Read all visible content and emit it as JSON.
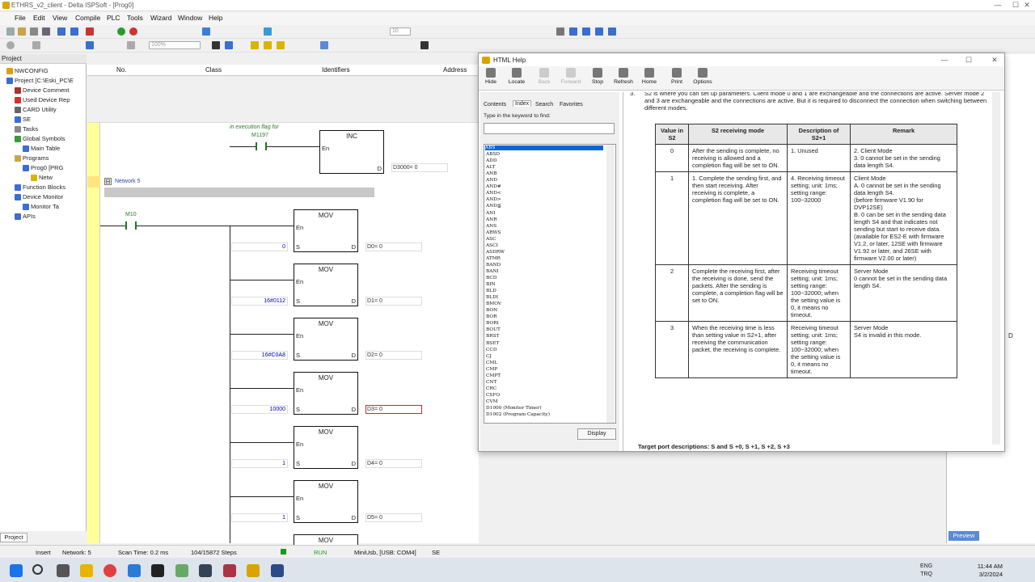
{
  "window": {
    "title": "ETHRS_v2_client - Delta ISPSoft - [Prog0]",
    "controls": [
      "—",
      "☐",
      "✕"
    ]
  },
  "menu": [
    "File",
    "Edit",
    "View",
    "Compile",
    "PLC",
    "Tools",
    "Wizard",
    "Window",
    "Help"
  ],
  "toolbar": {
    "zoom": "100%",
    "step": "10"
  },
  "project": {
    "header": "Project",
    "items": [
      {
        "label": "NWCONFIG",
        "indent": 0
      },
      {
        "label": "Project [C:\\Eski_PC\\E",
        "indent": 0
      },
      {
        "label": "Device Comment",
        "indent": 1
      },
      {
        "label": "Used Device Rep",
        "indent": 1
      },
      {
        "label": "CARD Utility",
        "indent": 1
      },
      {
        "label": "SE",
        "indent": 1
      },
      {
        "label": "Tasks",
        "indent": 1
      },
      {
        "label": "Global Symbols",
        "indent": 1
      },
      {
        "label": "Main Table",
        "indent": 2
      },
      {
        "label": "Programs",
        "indent": 1
      },
      {
        "label": "Prog0 [PRG",
        "indent": 2
      },
      {
        "label": "Netw",
        "indent": 3
      },
      {
        "label": "Function Blocks",
        "indent": 1
      },
      {
        "label": "Device Monitor",
        "indent": 1
      },
      {
        "label": "Monitor Ta",
        "indent": 2
      },
      {
        "label": "APIs",
        "indent": 1
      }
    ],
    "footer_tab": "Project"
  },
  "table_header": {
    "no": "No.",
    "class": "Class",
    "identifiers": "Identifiers",
    "address": "Address"
  },
  "ladder": {
    "comment": "in execution flag for",
    "network_label": "Network 5",
    "top_contact": "M1197",
    "inc_block": {
      "name": "INC",
      "en": "En",
      "d": "D",
      "out": "D3000= 0"
    },
    "contact": "M10",
    "movs": [
      {
        "name": "MOV",
        "src": "0",
        "out": "D0= 0"
      },
      {
        "name": "MOV",
        "src": "16#0112",
        "out": "D1= 0"
      },
      {
        "name": "MOV",
        "src": "16#C0A8",
        "out": "D2= 0"
      },
      {
        "name": "MOV",
        "src": "10000",
        "out": "D3= 0"
      },
      {
        "name": "MOV",
        "src": "1",
        "out": "D4= 0"
      },
      {
        "name": "MOV",
        "src": "1",
        "out": "D5= 0"
      },
      {
        "name": "MOV",
        "src": "",
        "out": ""
      }
    ],
    "pin_en": "En",
    "pin_s": "S",
    "pin_d": "D"
  },
  "help": {
    "title": "HTML Help",
    "tools": [
      {
        "label": "Hide",
        "enabled": true
      },
      {
        "label": "Locate",
        "enabled": true
      },
      {
        "label": "Back",
        "enabled": false
      },
      {
        "label": "Forward",
        "enabled": false
      },
      {
        "label": "Stop",
        "enabled": true
      },
      {
        "label": "Refresh",
        "enabled": true
      },
      {
        "label": "Home",
        "enabled": true
      },
      {
        "label": "Print",
        "enabled": true
      },
      {
        "label": "Options",
        "enabled": true
      }
    ],
    "tabs": [
      "Contents",
      "Index",
      "Search",
      "Favorites"
    ],
    "keyword_label": "Type in the keyword to find:",
    "keywords": [
      "ABS",
      "ABSD",
      "ADD",
      "ALT",
      "ANB",
      "AND",
      "AND#",
      "AND<",
      "AND>",
      "AND≦",
      "ANI",
      "ANR",
      "ANS",
      "ARWS",
      "ASC",
      "ASCI",
      "ASDRW",
      "ATMR",
      "BAND",
      "BANI",
      "BCD",
      "BIN",
      "BLD",
      "BLDI",
      "BMOV",
      "BON",
      "BOR",
      "BORI",
      "BOUT",
      "BRST",
      "BSET",
      "CCD",
      "CJ",
      "CML",
      "CMP",
      "CMPT",
      "CNT",
      "CRC",
      "CSFO",
      "CVM",
      "D1000 (Monitor Timer)",
      "D1002 (Program Capacity)"
    ],
    "display_button": "Display",
    "intro": "S2 is where you can set up parameters. Client mode 0 and 1 are exchangeable and the connections are active. Server mode 2 and 3 are exchangeable and the connections are active. But it is required to disconnect the connection when switching between different modes.",
    "intro_prefix": "3.",
    "table": {
      "headers": [
        "Value in S2",
        "S2 receiving mode",
        "Description of S2+1",
        "Remark"
      ],
      "rows": [
        {
          "value": "0",
          "mode": "After the sending is complete, no receiving is allowed and a completion flag will be set to ON.",
          "desc": "1.   Unused",
          "remark": "2.   Client Mode\n3.   0 cannot be set in the sending data length S4."
        },
        {
          "value": "1",
          "mode": "1.   Complete the sending first, and then start receiving. After receiving is complete, a completion flag will be set to ON.",
          "desc": "4.   Receiving timeout setting; unit: 1ms; setting range: 100~32000",
          "remark": "Client Mode\nA. 0 cannot be set in the sending data length S4.\n(before firmware V1.90 for DVP12SE)\nB. 0 can be set in the sending data length S4 and that indicates not sending but start to receive data. (available for ES2-E with firmware V1.2, or later, 12SE with firmware V1.92 or later, and 26SE with firmware V2.00 or later)"
        },
        {
          "value": "2",
          "mode": "Complete the receiving first, after the receiving is done, send the packets. After the sending is complete, a completion flag will be set to ON.",
          "desc": "Receiving timeout setting; unit: 1ms; setting range: 100~32000; when the setting value is 0, it means no timeout.",
          "remark": "Server Mode\n0 cannot be set in the sending data length S4."
        },
        {
          "value": "3",
          "mode": "When the receiving time is less than setting value in S2+1, after receiving the communication packet, the receiving is complete.",
          "desc": "Receiving timeout setting; unit: 1ms; setting range: 100~32000; when the setting value is 0, it means no timeout.",
          "remark": "Server Mode\nS4 is invalid in this mode."
        }
      ]
    },
    "footer_text": "Target port descriptions: S  and S +0, S +1, S +2, S +3"
  },
  "right_panel": {
    "tab": "Preview",
    "letter": "D"
  },
  "status": {
    "mode": "Insert",
    "network": "Network: 5",
    "scan": "Scan Time: 0.2 ms",
    "steps": "104/15872 Steps",
    "run": "RUN",
    "conn": "MiniUsb, [USB: COM4]",
    "plc": "SE"
  },
  "clock": {
    "time": "11:44 AM",
    "date": "3/2/2024",
    "lang1": "ENG",
    "lang2": "TRQ"
  },
  "colors": {
    "accent": "#0a64d8",
    "rail": "#ffff99",
    "run": "#1a9a1a"
  }
}
